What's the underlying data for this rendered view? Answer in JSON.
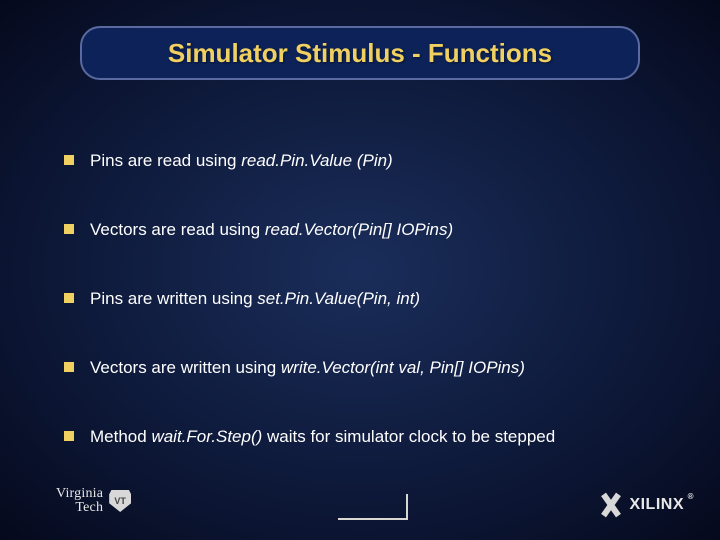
{
  "title": "Simulator Stimulus - Functions",
  "bullets": [
    {
      "plain": "Pins are read using ",
      "ital": "read.Pin.Value (Pin)",
      "tail": ""
    },
    {
      "plain": "Vectors are read using ",
      "ital": "read.Vector(Pin[] IOPins)",
      "tail": ""
    },
    {
      "plain": "Pins are written using ",
      "ital": "set.Pin.Value(Pin, int)",
      "tail": ""
    },
    {
      "plain": "Vectors are written using ",
      "ital": "write.Vector(int val, Pin[] IOPins)",
      "tail": ""
    },
    {
      "plain": "Method ",
      "ital": "wait.For.Step()",
      "tail": " waits for simulator clock to be stepped"
    }
  ],
  "footer": {
    "left_text": "Virginia",
    "left_sub": "Tech",
    "shield_text": "VT",
    "right_brand": "XILINX",
    "reg": "®"
  }
}
